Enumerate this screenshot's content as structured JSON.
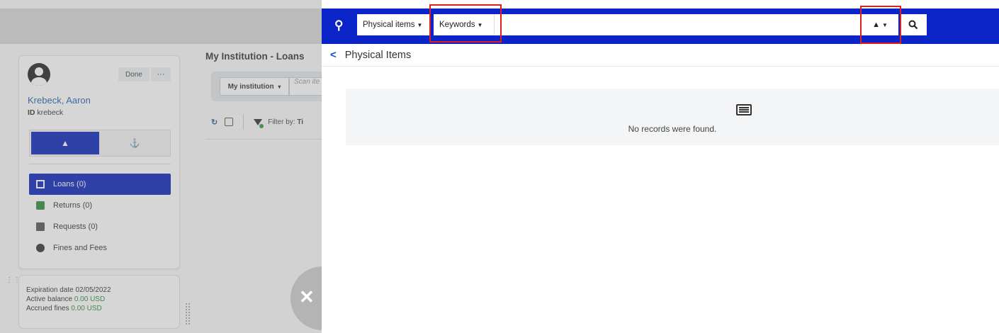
{
  "patient": {
    "name": "Krebeck, Aaron",
    "id_label": "ID",
    "id_value": "krebeck",
    "done_label": "Done",
    "more_label": "···"
  },
  "view_toggle": {
    "home_icon": "home-icon",
    "tree_icon": "hierarchy-icon"
  },
  "nav": {
    "items": [
      {
        "label": "Loans (0)",
        "icon": "loan-icon",
        "active": true
      },
      {
        "label": "Returns (0)",
        "icon": "return-icon",
        "active": false
      },
      {
        "label": "Requests (0)",
        "icon": "request-icon",
        "active": false
      },
      {
        "label": "Fines and Fees",
        "icon": "fine-icon",
        "active": false
      }
    ]
  },
  "info": {
    "expiration_label": "Expiration date",
    "expiration_value": "02/05/2022",
    "balance_label": "Active balance",
    "balance_value": "0.00 USD",
    "fines_label": "Accrued fines",
    "fines_value": "0.00 USD"
  },
  "loans": {
    "title": "My Institution - Loans",
    "scope_label": "My institution",
    "scan_placeholder": "Scan ite",
    "filter_label": "Filter by:",
    "filter_value": "Ti"
  },
  "search": {
    "type_label": "Physical items",
    "field_label": "Keywords",
    "query_value": "",
    "scope_icon": "home-icon",
    "go_icon": "search-icon"
  },
  "results": {
    "breadcrumb": "Physical Items",
    "empty_message": "No records were found."
  },
  "colors": {
    "brand_blue": "#0a24c8",
    "highlight_red": "#e02020",
    "balance_green": "#2e8b3a"
  }
}
